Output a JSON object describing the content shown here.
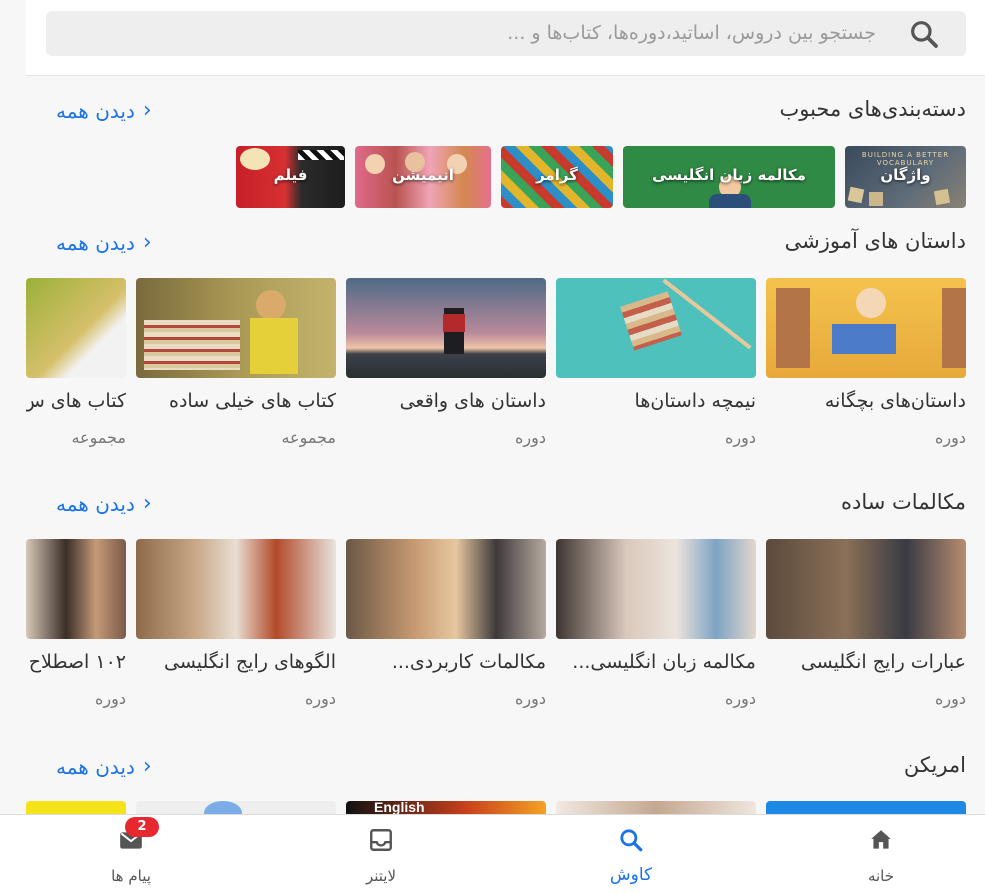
{
  "search": {
    "placeholder": "جستجو بین دروس، اساتید،دوره‌ها، کتاب‌ها و ..."
  },
  "sections": [
    {
      "title": "دسته‌بندی‌های محبوب",
      "see_all": "دیدن همه"
    },
    {
      "title": "داستان های آموزشی",
      "see_all": "دیدن همه"
    },
    {
      "title": "مکالمات ساده",
      "see_all": "دیدن همه"
    },
    {
      "title": "امریکن",
      "see_all": "دیدن همه"
    }
  ],
  "categories": [
    {
      "label": "واژگان",
      "image_text": "BUILDING A BETTER VOCABULARY"
    },
    {
      "label": "مکالمه زبان انگلیسی"
    },
    {
      "label": "گرامر"
    },
    {
      "label": "انیمیشن"
    },
    {
      "label": "فیلم"
    }
  ],
  "stories": [
    {
      "title": "داستان‌های بچگانه",
      "sub": "دوره"
    },
    {
      "title": "نیمچه داستان‌ها",
      "sub": "دوره"
    },
    {
      "title": "داستان های واقعی",
      "sub": "دوره"
    },
    {
      "title": "کتاب های خیلی ساده",
      "sub": "مجموعه"
    },
    {
      "title": "کتاب های س",
      "sub": "مجموعه"
    }
  ],
  "conversations": [
    {
      "title": "عبارات رایج انگلیسی",
      "sub": "دوره"
    },
    {
      "title": "مکالمه زبان انگلیسی...",
      "sub": "دوره"
    },
    {
      "title": "مکالمات کاربردی...",
      "sub": "دوره"
    },
    {
      "title": "الگوهای رایج انگلیسی",
      "sub": "دوره"
    },
    {
      "title": "۱۰۲ اصطلاح",
      "sub": "دوره"
    }
  ],
  "american": {
    "thumb_text": "English"
  },
  "nav": {
    "home": "خانه",
    "explore": "کاوش",
    "leitner": "لایتنر",
    "messages": "پیام ها",
    "messages_badge": "2"
  },
  "colors": {
    "accent": "#1a73e8",
    "badge": "#e8282f"
  }
}
